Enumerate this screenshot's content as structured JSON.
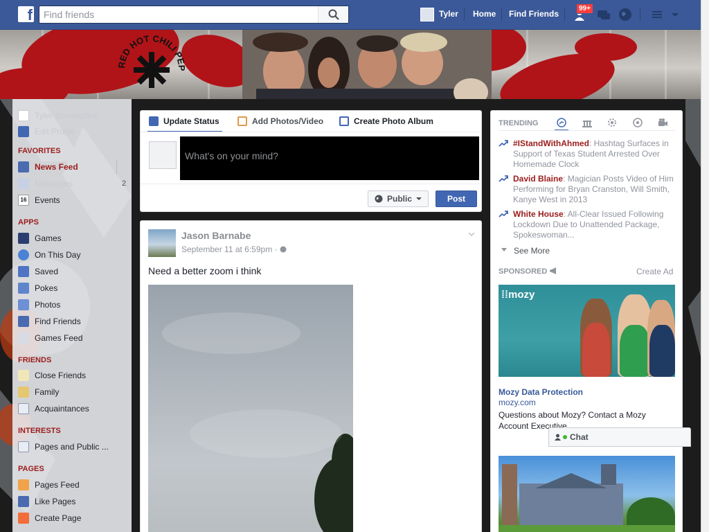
{
  "topbar": {
    "logo": "f",
    "search_placeholder": "Find friends",
    "user_name": "Tyler",
    "home": "Home",
    "find_friends": "Find Friends",
    "notif_count": "99+"
  },
  "cover": {
    "band_text": "RED HOT CHILI PEPPERS"
  },
  "left_nav": {
    "profile_name": "Tyler Screenshot",
    "edit_profile": "Edit Profile",
    "favorites_head": "FAVORITES",
    "favorites": [
      {
        "label": "News Feed",
        "count": ""
      },
      {
        "label": "Messages",
        "count": "2"
      },
      {
        "label": "Events",
        "count": ""
      }
    ],
    "apps_head": "APPS",
    "apps": [
      "Games",
      "On This Day",
      "Saved",
      "Pokes",
      "Photos",
      "Find Friends",
      "Games Feed"
    ],
    "friends_head": "FRIENDS",
    "friends": [
      "Close Friends",
      "Family",
      "Acquaintances"
    ],
    "interests_head": "INTERESTS",
    "interests": [
      "Pages and Public ..."
    ],
    "pages_head": "PAGES",
    "pages": [
      "Pages Feed",
      "Like Pages",
      "Create Page"
    ]
  },
  "composer": {
    "tabs": [
      "Update Status",
      "Add Photos/Video",
      "Create Photo Album"
    ],
    "placeholder": "What's on your mind?",
    "privacy": "Public",
    "post": "Post"
  },
  "post": {
    "author": "Jason Barnabe",
    "time": "September 11 at 6:59pm · ",
    "text": "Need a better zoom i think"
  },
  "trending": {
    "head": "TRENDING",
    "items": [
      {
        "name": "#IStandWithAhmed",
        "text": ": Hashtag Surfaces in Support of Texas Student Arrested Over Homemade Clock"
      },
      {
        "name": "David Blaine",
        "text": ": Magician Posts Video of Him Performing for Bryan Cranston, Will Smith, Kanye West in 2013"
      },
      {
        "name": "White House",
        "text": ": All-Clear Issued Following Lockdown Due to Unattended Package, Spokeswoman..."
      }
    ],
    "see_more": "See More"
  },
  "sponsored": {
    "head": "SPONSORED",
    "create_ad": "Create Ad",
    "logo": "mozy",
    "title": "Mozy Data Protection",
    "domain": "mozy.com",
    "desc": "Questions about Mozy? Contact a Mozy Account Executive."
  },
  "chat": {
    "label": "Chat"
  },
  "colors": {
    "brand": "#3b5998",
    "accent": "#4267b2",
    "favorite_head": "#9b1c1c"
  }
}
